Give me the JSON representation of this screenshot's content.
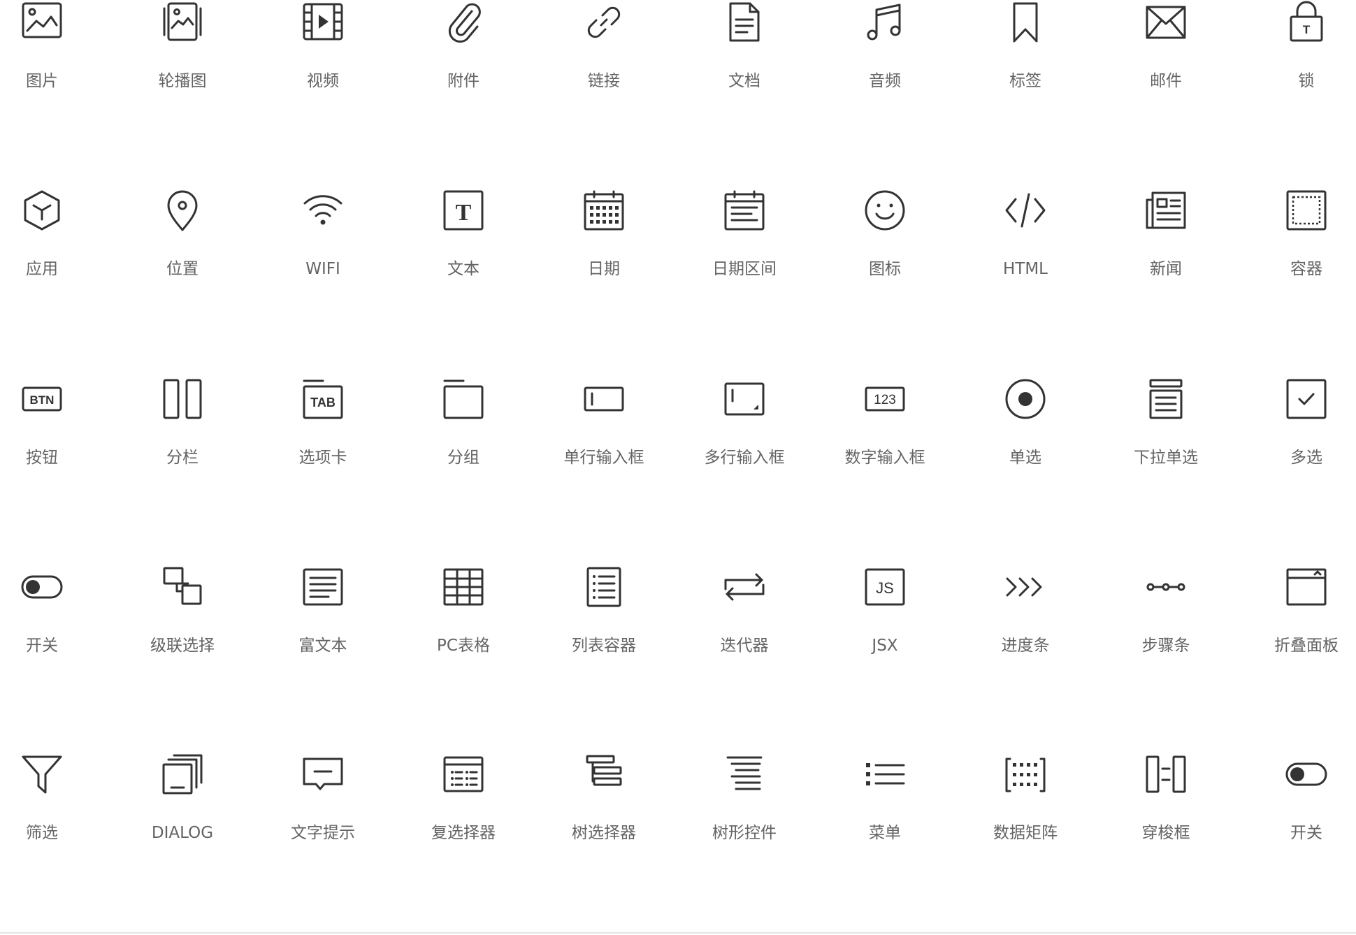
{
  "colors": {
    "icon": "#333333",
    "label": "#646464",
    "background": "#ffffff"
  },
  "palette": {
    "title": "",
    "items": [
      {
        "label": "图片",
        "icon": "image-icon"
      },
      {
        "label": "轮播图",
        "icon": "carousel-icon"
      },
      {
        "label": "视频",
        "icon": "video-icon"
      },
      {
        "label": "附件",
        "icon": "paperclip-icon"
      },
      {
        "label": "链接",
        "icon": "link-icon"
      },
      {
        "label": "文档",
        "icon": "document-icon"
      },
      {
        "label": "音频",
        "icon": "music-icon"
      },
      {
        "label": "标签",
        "icon": "bookmark-icon"
      },
      {
        "label": "邮件",
        "icon": "mail-icon"
      },
      {
        "label": "锁",
        "icon": "lock-icon"
      },
      {
        "label": "应用",
        "icon": "app-cube-icon"
      },
      {
        "label": "位置",
        "icon": "location-pin-icon"
      },
      {
        "label": "WIFI",
        "icon": "wifi-icon"
      },
      {
        "label": "文本",
        "icon": "text-icon"
      },
      {
        "label": "日期",
        "icon": "calendar-icon"
      },
      {
        "label": "日期区间",
        "icon": "date-range-icon"
      },
      {
        "label": "图标",
        "icon": "smiley-icon"
      },
      {
        "label": "HTML",
        "icon": "code-icon"
      },
      {
        "label": "新闻",
        "icon": "news-icon"
      },
      {
        "label": "容器",
        "icon": "container-icon"
      },
      {
        "label": "按钮",
        "icon": "button-icon"
      },
      {
        "label": "分栏",
        "icon": "columns-icon"
      },
      {
        "label": "选项卡",
        "icon": "tabs-icon"
      },
      {
        "label": "分组",
        "icon": "group-icon"
      },
      {
        "label": "单行输入框",
        "icon": "single-line-input-icon"
      },
      {
        "label": "多行输入框",
        "icon": "multi-line-input-icon"
      },
      {
        "label": "数字输入框",
        "icon": "number-input-icon"
      },
      {
        "label": "单选",
        "icon": "radio-icon"
      },
      {
        "label": "下拉单选",
        "icon": "dropdown-select-icon"
      },
      {
        "label": "多选",
        "icon": "checkbox-icon"
      },
      {
        "label": "开关",
        "icon": "toggle-switch-icon"
      },
      {
        "label": "级联选择",
        "icon": "cascader-icon"
      },
      {
        "label": "富文本",
        "icon": "rich-text-icon"
      },
      {
        "label": "PC表格",
        "icon": "table-grid-icon"
      },
      {
        "label": "列表容器",
        "icon": "list-container-icon"
      },
      {
        "label": "迭代器",
        "icon": "iterator-icon"
      },
      {
        "label": "JSX",
        "icon": "jsx-icon"
      },
      {
        "label": "进度条",
        "icon": "progress-chevrons-icon"
      },
      {
        "label": "步骤条",
        "icon": "steps-icon"
      },
      {
        "label": "折叠面板",
        "icon": "collapse-panel-icon"
      },
      {
        "label": "筛选",
        "icon": "filter-icon"
      },
      {
        "label": "DIALOG",
        "icon": "dialog-icon"
      },
      {
        "label": "文字提示",
        "icon": "tooltip-icon"
      },
      {
        "label": "复选择器",
        "icon": "multi-picker-icon"
      },
      {
        "label": "树选择器",
        "icon": "tree-select-icon"
      },
      {
        "label": "树形控件",
        "icon": "tree-control-icon"
      },
      {
        "label": "菜单",
        "icon": "menu-list-icon"
      },
      {
        "label": "数据矩阵",
        "icon": "data-matrix-icon"
      },
      {
        "label": "穿梭框",
        "icon": "transfer-icon"
      },
      {
        "label": "开关",
        "icon": "toggle-switch-icon"
      }
    ]
  }
}
